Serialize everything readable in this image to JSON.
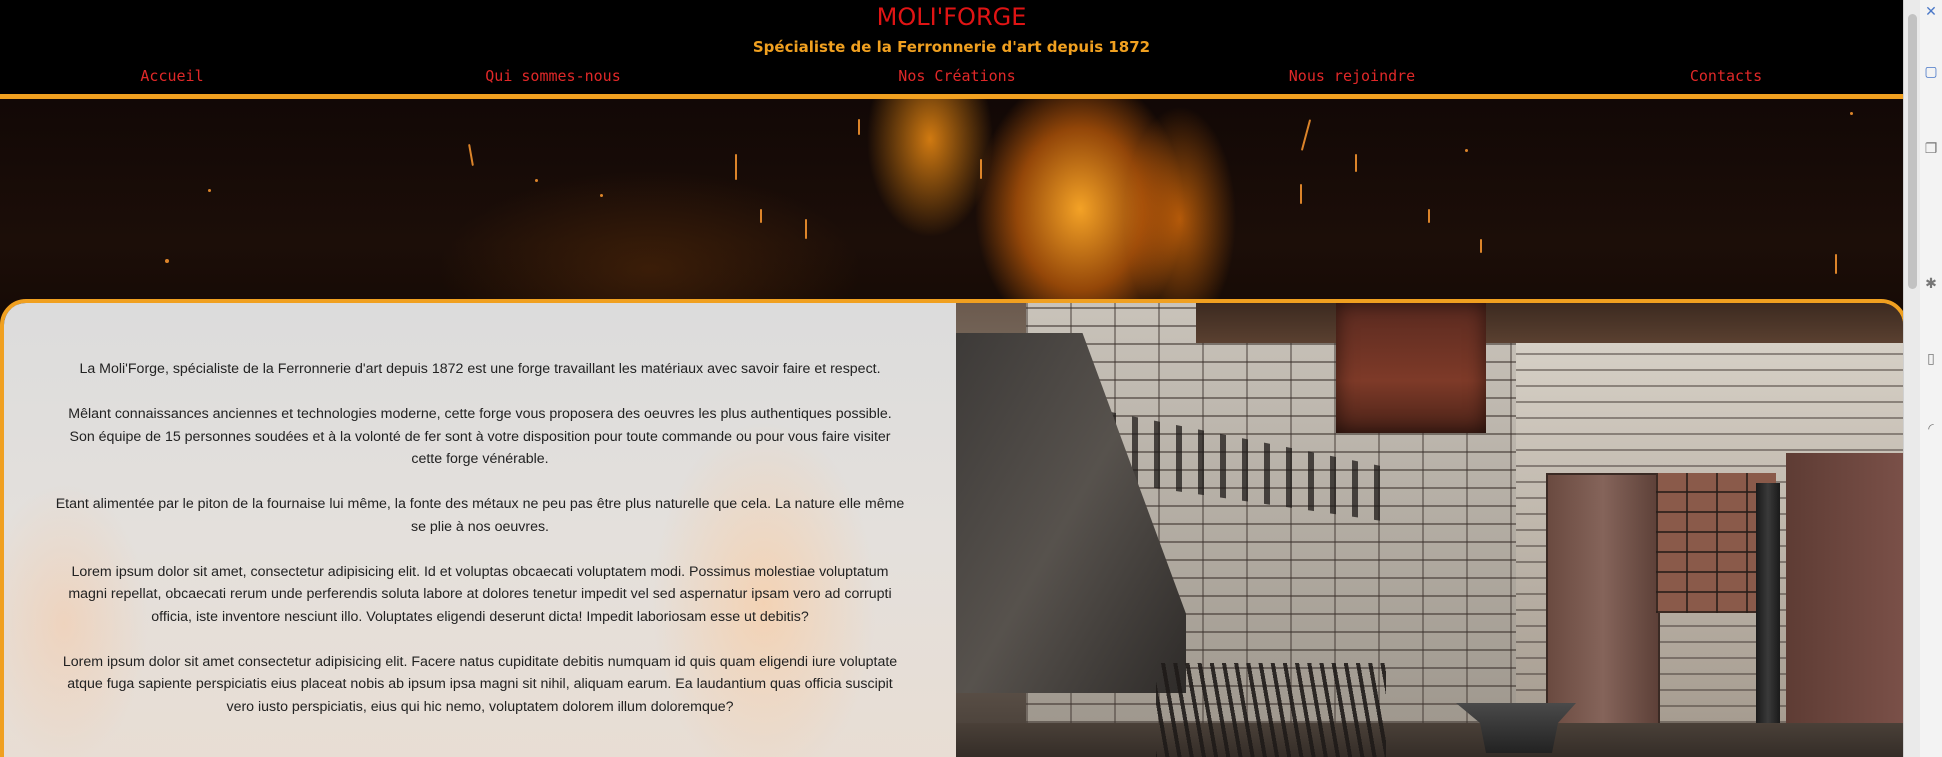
{
  "header": {
    "title": "MOLI'FORGE",
    "tagline": "Spécialiste de la Ferronnerie d'art depuis 1872"
  },
  "nav": {
    "items": [
      {
        "label": "Accueil"
      },
      {
        "label": "Qui sommes-nous"
      },
      {
        "label": "Nos Créations"
      },
      {
        "label": "Nous rejoindre"
      },
      {
        "label": "Contacts"
      }
    ]
  },
  "content": {
    "paragraphs": [
      "La Moli'Forge, spécialiste de la Ferronnerie d'art depuis 1872 est une forge travaillant les matériaux avec savoir faire et respect.",
      "Mêlant connaissances anciennes et technologies moderne, cette forge vous proposera des oeuvres les plus authentiques possible. Son équipe de 15 personnes soudées et à la volonté de fer sont à votre disposition pour toute commande ou pour vous faire visiter cette forge vénérable.",
      "Etant alimentée par le piton de la fournaise lui même, la fonte des métaux ne peu pas être plus naturelle que cela. La nature elle même se plie à nos oeuvres.",
      "Lorem ipsum dolor sit amet, consectetur adipisicing elit. Id et voluptas obcaecati voluptatem modi. Possimus molestiae voluptatum magni repellat, obcaecati rerum unde perferendis soluta labore at dolores tenetur impedit vel sed aspernatur ipsam vero ad corrupti officia, iste inventore nesciunt illo. Voluptates eligendi deserunt dicta! Impedit laboriosam esse ut debitis?",
      "Lorem ipsum dolor sit amet consectetur adipisicing elit. Facere natus cupiditate debitis numquam id quis quam eligendi iure voluptate atque fuga sapiente perspiciatis eius placeat nobis ab ipsum ipsa magni sit nihil, aliquam earum. Ea laudantium quas officia suscipit vero iusto perspiciatis, eius qui hic nemo, voluptatem dolorem illum doloremque?"
    ]
  },
  "colors": {
    "title_red": "#e01414",
    "accent_orange": "#f0a020",
    "nav_red": "#e02828",
    "background": "#000000"
  },
  "icons": {
    "side": [
      "close-icon",
      "panel-icon",
      "copy-icon",
      "settings-icon",
      "sidebar-icon",
      "loader-icon"
    ]
  }
}
